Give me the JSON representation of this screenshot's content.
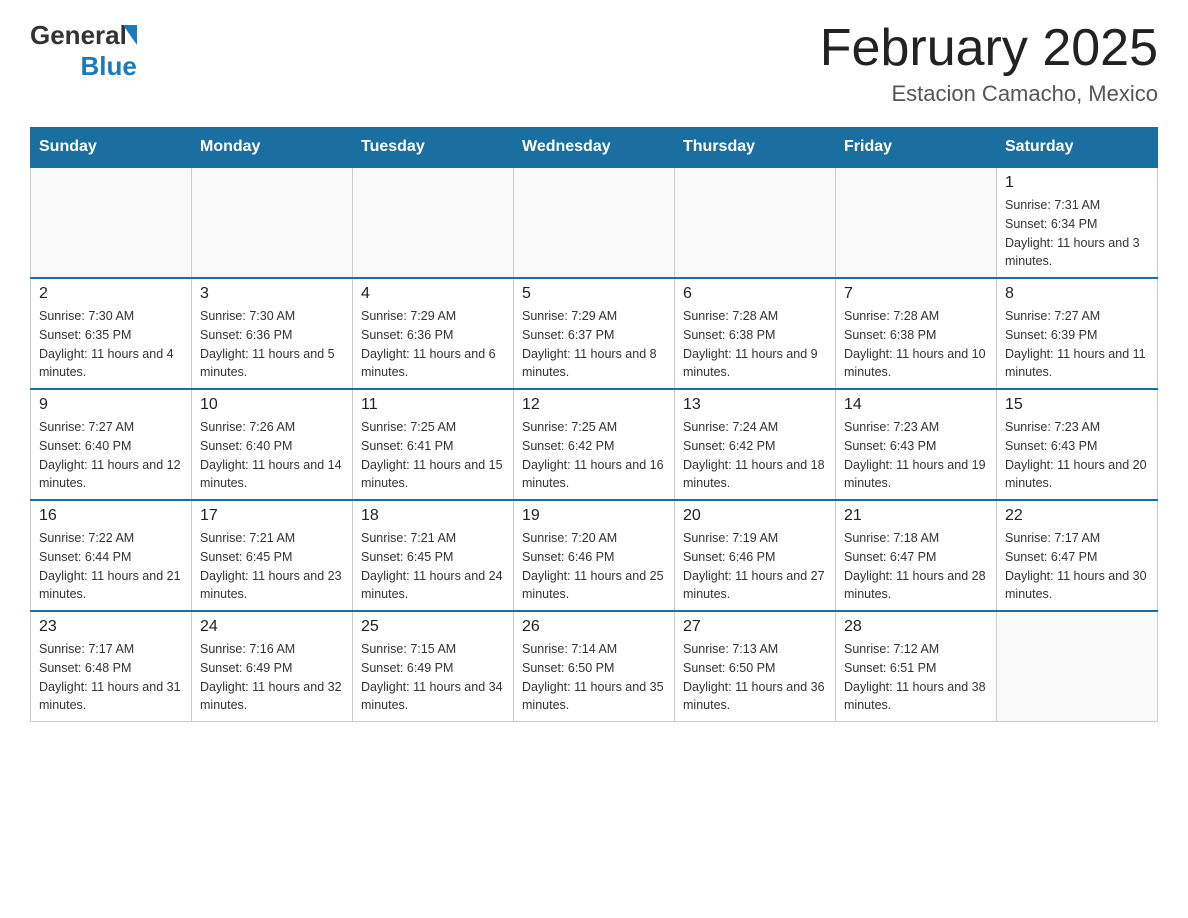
{
  "header": {
    "logo_general": "General",
    "logo_blue": "Blue",
    "month_title": "February 2025",
    "location": "Estacion Camacho, Mexico"
  },
  "days_of_week": [
    "Sunday",
    "Monday",
    "Tuesday",
    "Wednesday",
    "Thursday",
    "Friday",
    "Saturday"
  ],
  "weeks": [
    [
      {
        "day": "",
        "info": ""
      },
      {
        "day": "",
        "info": ""
      },
      {
        "day": "",
        "info": ""
      },
      {
        "day": "",
        "info": ""
      },
      {
        "day": "",
        "info": ""
      },
      {
        "day": "",
        "info": ""
      },
      {
        "day": "1",
        "info": "Sunrise: 7:31 AM\nSunset: 6:34 PM\nDaylight: 11 hours and 3 minutes."
      }
    ],
    [
      {
        "day": "2",
        "info": "Sunrise: 7:30 AM\nSunset: 6:35 PM\nDaylight: 11 hours and 4 minutes."
      },
      {
        "day": "3",
        "info": "Sunrise: 7:30 AM\nSunset: 6:36 PM\nDaylight: 11 hours and 5 minutes."
      },
      {
        "day": "4",
        "info": "Sunrise: 7:29 AM\nSunset: 6:36 PM\nDaylight: 11 hours and 6 minutes."
      },
      {
        "day": "5",
        "info": "Sunrise: 7:29 AM\nSunset: 6:37 PM\nDaylight: 11 hours and 8 minutes."
      },
      {
        "day": "6",
        "info": "Sunrise: 7:28 AM\nSunset: 6:38 PM\nDaylight: 11 hours and 9 minutes."
      },
      {
        "day": "7",
        "info": "Sunrise: 7:28 AM\nSunset: 6:38 PM\nDaylight: 11 hours and 10 minutes."
      },
      {
        "day": "8",
        "info": "Sunrise: 7:27 AM\nSunset: 6:39 PM\nDaylight: 11 hours and 11 minutes."
      }
    ],
    [
      {
        "day": "9",
        "info": "Sunrise: 7:27 AM\nSunset: 6:40 PM\nDaylight: 11 hours and 12 minutes."
      },
      {
        "day": "10",
        "info": "Sunrise: 7:26 AM\nSunset: 6:40 PM\nDaylight: 11 hours and 14 minutes."
      },
      {
        "day": "11",
        "info": "Sunrise: 7:25 AM\nSunset: 6:41 PM\nDaylight: 11 hours and 15 minutes."
      },
      {
        "day": "12",
        "info": "Sunrise: 7:25 AM\nSunset: 6:42 PM\nDaylight: 11 hours and 16 minutes."
      },
      {
        "day": "13",
        "info": "Sunrise: 7:24 AM\nSunset: 6:42 PM\nDaylight: 11 hours and 18 minutes."
      },
      {
        "day": "14",
        "info": "Sunrise: 7:23 AM\nSunset: 6:43 PM\nDaylight: 11 hours and 19 minutes."
      },
      {
        "day": "15",
        "info": "Sunrise: 7:23 AM\nSunset: 6:43 PM\nDaylight: 11 hours and 20 minutes."
      }
    ],
    [
      {
        "day": "16",
        "info": "Sunrise: 7:22 AM\nSunset: 6:44 PM\nDaylight: 11 hours and 21 minutes."
      },
      {
        "day": "17",
        "info": "Sunrise: 7:21 AM\nSunset: 6:45 PM\nDaylight: 11 hours and 23 minutes."
      },
      {
        "day": "18",
        "info": "Sunrise: 7:21 AM\nSunset: 6:45 PM\nDaylight: 11 hours and 24 minutes."
      },
      {
        "day": "19",
        "info": "Sunrise: 7:20 AM\nSunset: 6:46 PM\nDaylight: 11 hours and 25 minutes."
      },
      {
        "day": "20",
        "info": "Sunrise: 7:19 AM\nSunset: 6:46 PM\nDaylight: 11 hours and 27 minutes."
      },
      {
        "day": "21",
        "info": "Sunrise: 7:18 AM\nSunset: 6:47 PM\nDaylight: 11 hours and 28 minutes."
      },
      {
        "day": "22",
        "info": "Sunrise: 7:17 AM\nSunset: 6:47 PM\nDaylight: 11 hours and 30 minutes."
      }
    ],
    [
      {
        "day": "23",
        "info": "Sunrise: 7:17 AM\nSunset: 6:48 PM\nDaylight: 11 hours and 31 minutes."
      },
      {
        "day": "24",
        "info": "Sunrise: 7:16 AM\nSunset: 6:49 PM\nDaylight: 11 hours and 32 minutes."
      },
      {
        "day": "25",
        "info": "Sunrise: 7:15 AM\nSunset: 6:49 PM\nDaylight: 11 hours and 34 minutes."
      },
      {
        "day": "26",
        "info": "Sunrise: 7:14 AM\nSunset: 6:50 PM\nDaylight: 11 hours and 35 minutes."
      },
      {
        "day": "27",
        "info": "Sunrise: 7:13 AM\nSunset: 6:50 PM\nDaylight: 11 hours and 36 minutes."
      },
      {
        "day": "28",
        "info": "Sunrise: 7:12 AM\nSunset: 6:51 PM\nDaylight: 11 hours and 38 minutes."
      },
      {
        "day": "",
        "info": ""
      }
    ]
  ]
}
